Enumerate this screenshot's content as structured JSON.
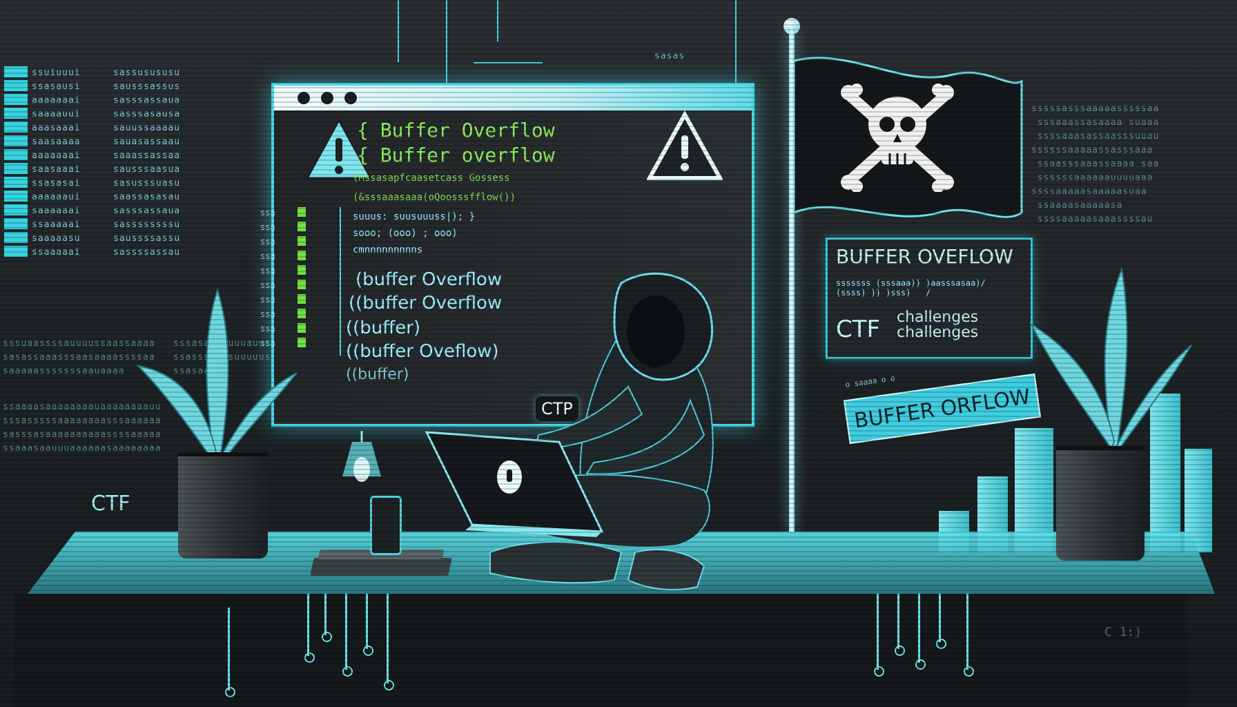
{
  "terminal": {
    "title_lines": [
      "{ Buffer Overflow",
      "{ Buffer overflow"
    ],
    "code_lines": [
      "buffer Overflow",
      "buffer Overflow",
      "buffer)",
      "buffer Oveflow)",
      "buffer)"
    ],
    "garbled": [
      "(Mssasapfcaasetcass Gossess",
      "(&sssaaasaaa(oQoosssfflow())",
      "suuus: suusuuuss|); }",
      "sooo; (ooo) ; ooo)",
      "cmnnnnnnnnns"
    ],
    "badge": "CTP"
  },
  "right_panel": {
    "heading": "BUFFER OVEFLOW",
    "sub1": "CTF",
    "sub2": "challenges",
    "sub3": "challenges",
    "button": "BUFFER ORFLOW"
  },
  "left_label": "CTF",
  "corner_label": "C 1:)",
  "colors": {
    "accent": "#49d9e8",
    "code_green": "#8ff05a",
    "bg": "#1f2326"
  },
  "icons": [
    "warning-icon",
    "skull-crossbones-icon",
    "lock-icon",
    "lamp-icon"
  ]
}
